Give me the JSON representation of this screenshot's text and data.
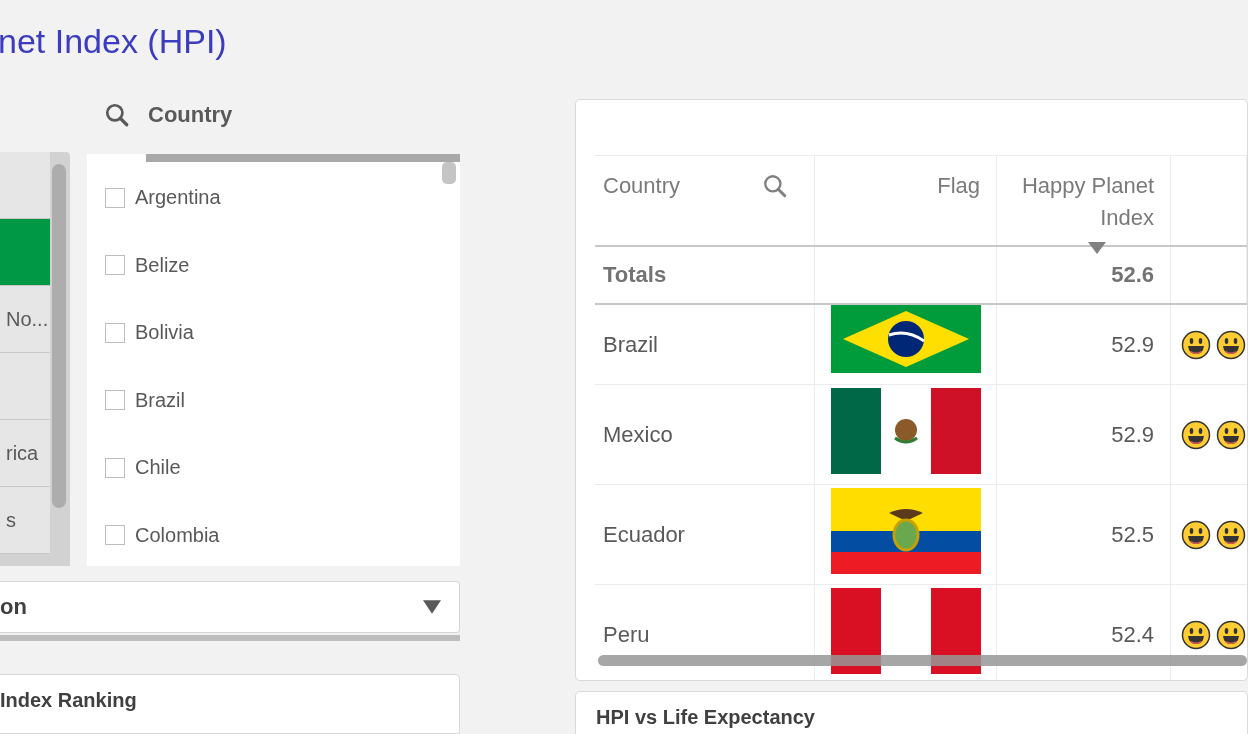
{
  "page_title": "net Index (HPI)",
  "region_list": {
    "items": [
      {
        "selected": false
      },
      {
        "selected": true
      },
      {
        "label": "No...",
        "selected": false
      },
      {
        "selected": false
      },
      {
        "label": "rica",
        "selected": false
      },
      {
        "label": "s",
        "selected": false
      }
    ]
  },
  "country_filter": {
    "title": "Country",
    "items": [
      {
        "label": "Argentina",
        "checked": false
      },
      {
        "label": "Belize",
        "checked": false
      },
      {
        "label": "Bolivia",
        "checked": false
      },
      {
        "label": "Brazil",
        "checked": false
      },
      {
        "label": "Chile",
        "checked": false
      },
      {
        "label": "Colombia",
        "checked": false
      }
    ]
  },
  "dropdown": {
    "value": "on"
  },
  "table": {
    "columns": [
      {
        "label": "Country",
        "search": true,
        "sorted": false
      },
      {
        "label": "Flag",
        "search": false,
        "sorted": false
      },
      {
        "label": "Happy Planet Index",
        "search": false,
        "sorted": true
      }
    ],
    "totals": {
      "label": "Totals",
      "value": "52.6"
    },
    "rows": [
      {
        "country": "Brazil",
        "flag": {
          "kind": "brazil"
        },
        "hpi": "52.9",
        "smileys": [
          {
            "kind": "grin"
          },
          {
            "kind": "grin"
          }
        ]
      },
      {
        "country": "Mexico",
        "flag": {
          "kind": "mexico"
        },
        "hpi": "52.9",
        "smileys": [
          {
            "kind": "grin"
          },
          {
            "kind": "grin"
          }
        ]
      },
      {
        "country": "Ecuador",
        "flag": {
          "kind": "ecuador"
        },
        "hpi": "52.5",
        "smileys": [
          {
            "kind": "grin"
          },
          {
            "kind": "grin"
          }
        ]
      },
      {
        "country": "Peru",
        "flag": {
          "kind": "peru"
        },
        "hpi": "52.4",
        "smileys": [
          {
            "kind": "grin"
          },
          {
            "kind": "grin"
          }
        ]
      }
    ]
  },
  "bottom_cards": [
    {
      "title": "Index Ranking"
    },
    {
      "title": "HPI vs Life Expectancy"
    }
  ]
}
